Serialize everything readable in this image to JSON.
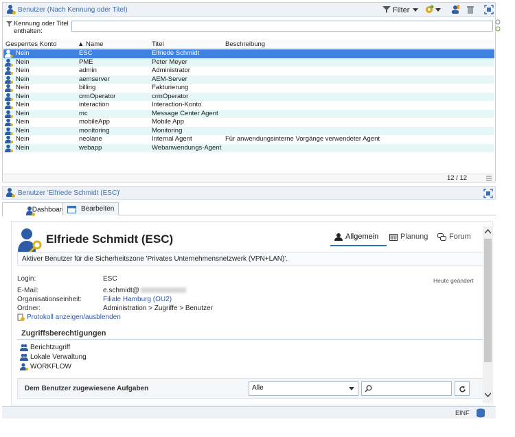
{
  "top": {
    "title": "Benutzer (Nach Kennung oder Titel)",
    "filter_label": "Filter",
    "search_label": "Kennung oder Titel enthalten:",
    "columns": [
      "Gesperrtes Konto",
      "Name",
      "Titel",
      "Beschreibung"
    ],
    "rows": [
      {
        "locked": "Nein",
        "name": "ESC",
        "title": "Elfriede Schmidt",
        "desc": ""
      },
      {
        "locked": "Nein",
        "name": "PME",
        "title": "Peter Meyer",
        "desc": ""
      },
      {
        "locked": "Nein",
        "name": "admin",
        "title": "Administrator",
        "desc": ""
      },
      {
        "locked": "Nein",
        "name": "aemserver",
        "title": "AEM-Server",
        "desc": ""
      },
      {
        "locked": "Nein",
        "name": "billing",
        "title": "Fakturierung",
        "desc": ""
      },
      {
        "locked": "Nein",
        "name": "crmOperator",
        "title": "crmOperator",
        "desc": ""
      },
      {
        "locked": "Nein",
        "name": "interaction",
        "title": "Interaction-Konto",
        "desc": ""
      },
      {
        "locked": "Nein",
        "name": "mc",
        "title": "Message Center Agent",
        "desc": ""
      },
      {
        "locked": "Nein",
        "name": "mobileApp",
        "title": "Mobile App",
        "desc": ""
      },
      {
        "locked": "Nein",
        "name": "monitoring",
        "title": "Monitoring",
        "desc": ""
      },
      {
        "locked": "Nein",
        "name": "neolane",
        "title": "Internal Agent",
        "desc": "Für anwendungsinterne Vorgänge verwendeter Agent"
      },
      {
        "locked": "Nein",
        "name": "webapp",
        "title": "Webanwendungs-Agent",
        "desc": ""
      }
    ],
    "counter": "12 / 12"
  },
  "bottom": {
    "title": "Benutzer 'Elfriede Schmidt (ESC)'",
    "tabs": [
      "Dashboard",
      "Bearbeiten"
    ]
  },
  "detail": {
    "user_name": "Elfriede Schmidt (ESC)",
    "view_tabs": [
      "Allgemein",
      "Planung",
      "Forum"
    ],
    "security_note": "Aktiver Benutzer für die Sicherheitszone 'Privates Unternehmensnetzwerk (VPN+LAN)'.",
    "changed": "Heute geändert",
    "fields": {
      "login_label": "Login:",
      "login": "ESC",
      "email_label": "E-Mail:",
      "email": "e.schmidt@",
      "org_label": "Organisationseinheit:",
      "org": "Filiale Hamburg (OU2)",
      "folder_label": "Ordner:",
      "folder": "Administration > Zugriffe > Benutzer"
    },
    "log_link": "Protokoll anzeigen/ausblenden",
    "permissions_title": "Zugriffsberechtigungen",
    "permissions": [
      "Berichtzugriff",
      "Lokale Verwaltung",
      "WORKFLOW"
    ],
    "tasks_title": "Dem Benutzer zugewiesene Aufgaben",
    "tasks_filter": "Alle"
  },
  "status": {
    "lang": "EINF"
  },
  "colors": {
    "accent": "#3f81e0",
    "link": "#2e56a8",
    "header_text": "#3b6fb5"
  }
}
